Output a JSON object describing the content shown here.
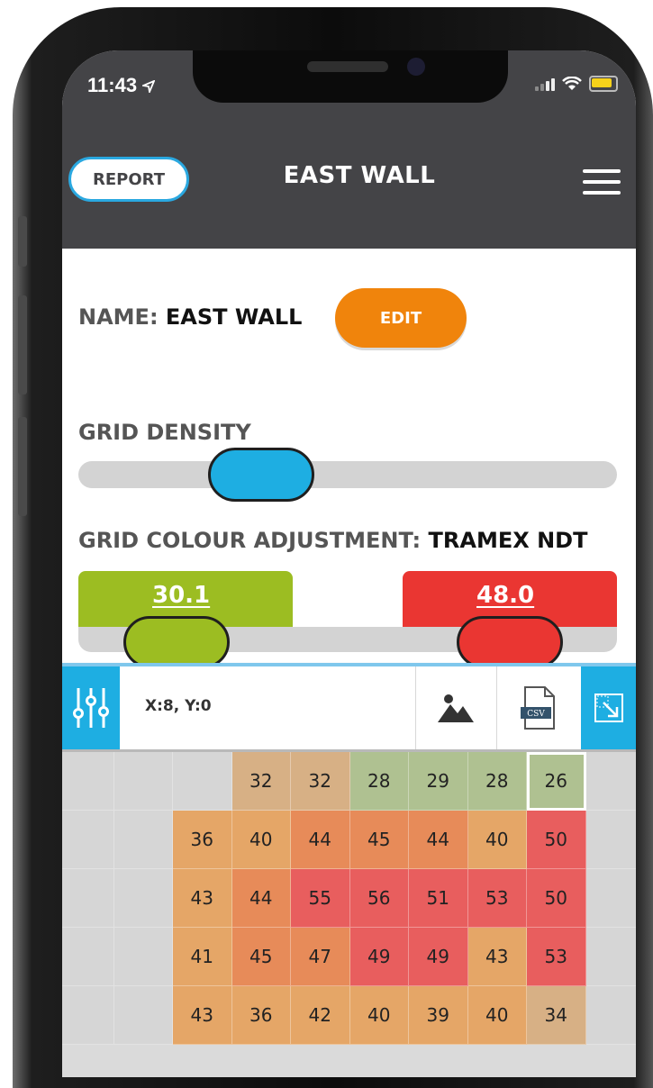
{
  "status_bar": {
    "time": "11:43"
  },
  "header": {
    "report_label": "REPORT",
    "title": "EAST WALL"
  },
  "settings": {
    "name_label": "NAME:",
    "name_value": "EAST WALL",
    "edit_label": "EDIT",
    "grid_density_label": "GRID DENSITY",
    "grid_density_level": 0.3,
    "colour_label": "GRID COLOUR ADJUSTMENT:",
    "colour_profile": "TRAMEX NDT",
    "low_value": "30.1",
    "high_value": "48.0"
  },
  "toolbar": {
    "coords": "X:8, Y:0",
    "csv_label": "CSV",
    "icons": [
      "sliders-icon",
      "image-icon",
      "csv-file-icon",
      "expand-icon"
    ]
  },
  "grid": {
    "selected": {
      "row": 0,
      "col": 8
    },
    "rows": [
      [
        null,
        null,
        null,
        32,
        32,
        28,
        29,
        28,
        26,
        null
      ],
      [
        null,
        null,
        36,
        40,
        44,
        45,
        44,
        40,
        50,
        null
      ],
      [
        null,
        null,
        43,
        44,
        55,
        56,
        51,
        53,
        50,
        null
      ],
      [
        null,
        null,
        41,
        45,
        47,
        49,
        49,
        43,
        53,
        null
      ],
      [
        null,
        null,
        43,
        36,
        42,
        40,
        39,
        40,
        34,
        null
      ]
    ]
  },
  "colors": {
    "header_bg": "#444447",
    "accent_blue": "#1eaee2",
    "edit_orange": "#f0840c",
    "low_green": "#9cbd22",
    "high_red": "#ea3632"
  }
}
